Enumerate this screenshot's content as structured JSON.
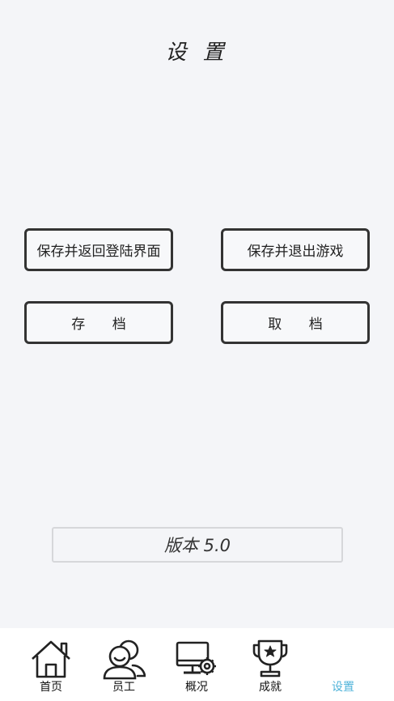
{
  "header": {
    "title": "设 置"
  },
  "actions": {
    "return_login_label": "保存并返回登陆界面",
    "exit_game_label": "保存并退出游戏",
    "save_label": "存 档",
    "load_label": "取 档"
  },
  "version": {
    "label": "版本 5.0"
  },
  "tabs": [
    {
      "label": "首页",
      "icon": "house-icon"
    },
    {
      "label": "员工",
      "icon": "people-icon"
    },
    {
      "label": "概况",
      "icon": "monitor-gear-icon"
    },
    {
      "label": "成就",
      "icon": "trophy-icon"
    },
    {
      "label": "设置",
      "icon": "",
      "active": true
    }
  ],
  "colors": {
    "active_tab": "#4fb3d9",
    "background": "#f4f5f8",
    "border": "#333333"
  }
}
